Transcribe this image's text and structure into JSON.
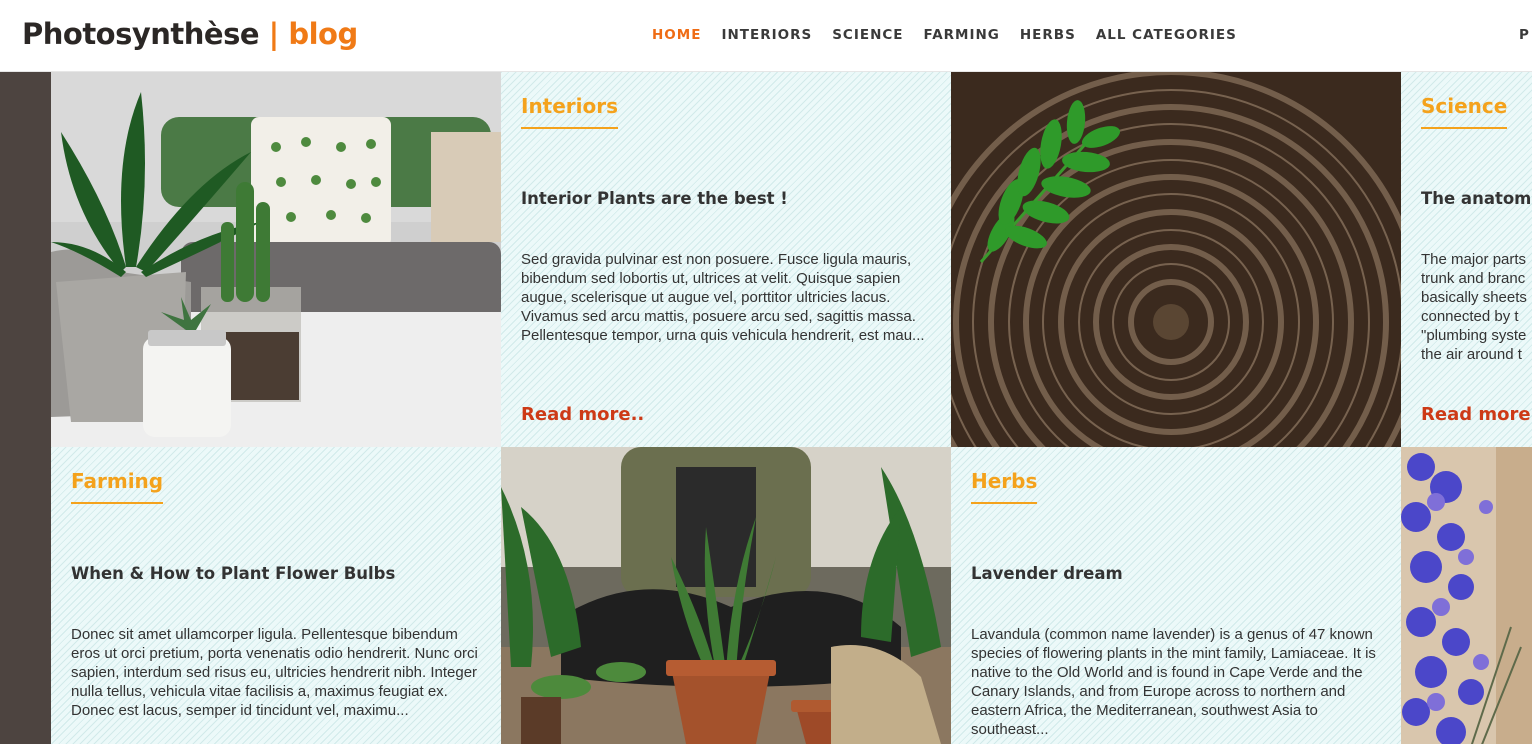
{
  "brand": {
    "name": "Photosynthèse",
    "separator": "|",
    "suffix": "blog"
  },
  "nav": {
    "items": [
      "HOME",
      "INTERIORS",
      "SCIENCE",
      "FARMING",
      "HERBS",
      "ALL CATEGORIES"
    ],
    "active": "HOME",
    "clipped_item": "P"
  },
  "posts": [
    {
      "category": "Interiors",
      "title": "Interior Plants are the best !",
      "excerpt": "Sed gravida pulvinar est non posuere. Fusce ligula mauris, bibendum sed lobortis ut, ultrices at velit. Quisque sapien augue, scelerisque ut augue vel, porttitor ultricies lacus. Vivamus sed arcu mattis, posuere arcu sed, sagittis massa. Pellentesque tempor, urna quis vehicula hendrerit, est mau...",
      "read_more": "Read more.."
    },
    {
      "category": "Science",
      "title": "The anatom",
      "excerpt_lines": [
        "The major parts",
        "trunk and branc",
        "basically sheets",
        "connected by t",
        "\"plumbing syste",
        "the air around t"
      ],
      "read_more": "Read more"
    },
    {
      "category": "Farming",
      "title": "When & How to Plant Flower Bulbs",
      "excerpt": "Donec sit amet ullamcorper ligula. Pellentesque bibendum eros ut orci pretium, porta venenatis odio hendrerit. Nunc orci sapien, interdum sed risus eu, ultricies hendrerit nibh. Integer nulla tellus, vehicula vitae facilisis a, maximus feugiat ex. Donec est lacus, semper id tincidunt vel, maximu..."
    },
    {
      "category": "Herbs",
      "title": "Lavender dream",
      "excerpt": "Lavandula (common name lavender) is a genus of 47 known species of flowering plants in the mint family, Lamiaceae. It is native to the Old World and is found in Cape Verde and the Canary Islands, and from Europe across to northern and eastern Africa, the Mediterranean, southwest Asia to southeast..."
    }
  ],
  "colors": {
    "accent_orange": "#f07a16",
    "category_gold": "#f4a21c",
    "read_more_red": "#cd3a16",
    "tile_bg": "#ecf9f9",
    "left_strip": "#4d4440"
  }
}
